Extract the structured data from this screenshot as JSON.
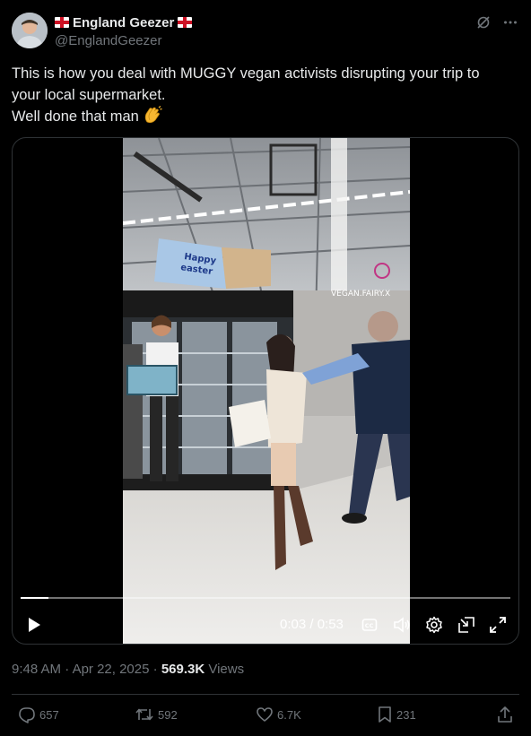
{
  "author": {
    "display_name": "England Geezer",
    "handle": "@EnglandGeezer",
    "avatar_icon": "person-avatar"
  },
  "tweet": {
    "lines": [
      "This is how you deal with MUGGY vegan activists disrupting your trip to",
      "your local supermarket.",
      "Well done that man"
    ],
    "emoji_icon": "clapping-hands-icon"
  },
  "video": {
    "overlay_watermark": "VEGAN.FAIRY.X",
    "sign_text_1": "Happy",
    "sign_text_2": "easter",
    "time_current": "0:03",
    "time_total": "0:53",
    "time_display": "0:03 / 0:53",
    "progress_fraction": 0.057
  },
  "meta": {
    "time": "9:48 AM",
    "date": "Apr 22, 2025",
    "views_count": "569.3K",
    "views_label": "Views"
  },
  "actions": {
    "replies": "657",
    "reposts": "592",
    "likes": "6.7K",
    "bookmarks": "231"
  },
  "colors": {
    "background": "#000000",
    "text_primary": "#e7e9ea",
    "text_secondary": "#71767b",
    "divider": "#2f3336"
  }
}
